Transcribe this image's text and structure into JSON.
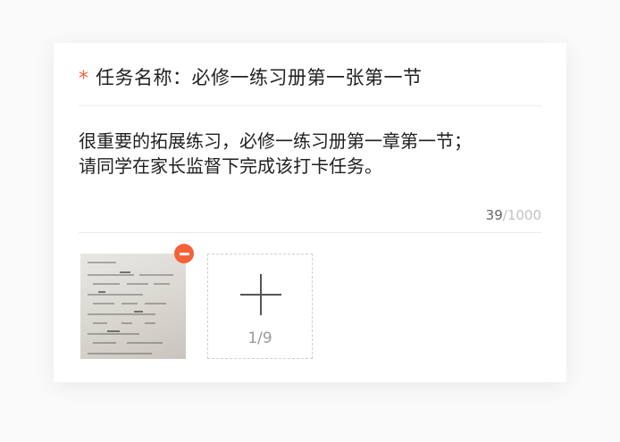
{
  "form": {
    "required_mark": "*",
    "task_name": "任务名称：必修一练习册第一张第一节",
    "description_line1": "很重要的拓展练习，必修一练习册第一章第一节；",
    "description_line2": "请同学在家长监督下完成该打卡任务。",
    "char_count_current": "39",
    "char_count_max": "/1000"
  },
  "attachments": {
    "image_count_label": "1/9",
    "images": [
      {
        "icon": "worksheet-photo"
      }
    ],
    "remove_icon": "minus-circle-icon",
    "add_icon": "plus-icon"
  },
  "colors": {
    "accent": "#f4623a",
    "text_primary": "#222222",
    "text_muted": "#c2c2c2",
    "divider": "#ececec"
  }
}
